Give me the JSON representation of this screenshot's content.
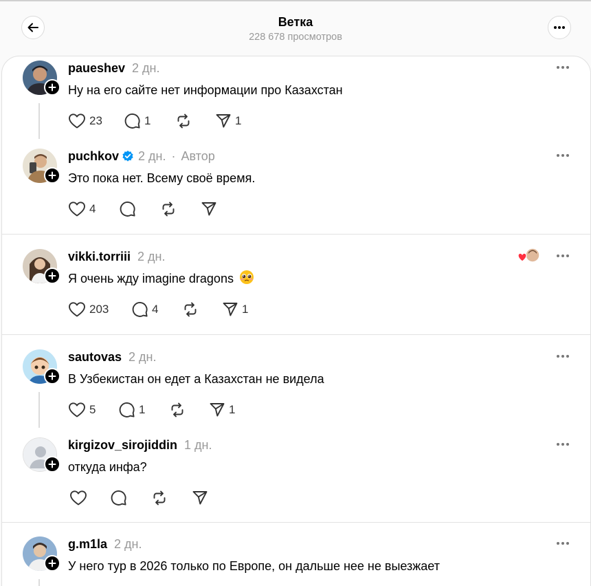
{
  "header": {
    "title": "Ветка",
    "subtitle": "228 678 просмотров"
  },
  "posts": [
    {
      "username": "paueshev",
      "time": "2 дн.",
      "text": "Ну на его сайте нет информации про Казахстан",
      "likes": "23",
      "replies": "1",
      "reposts": "",
      "shares": "1",
      "avatar_color": "#3b3b45"
    },
    {
      "username": "puchkov",
      "time": "2 дн.",
      "author_label": "Автор",
      "text": "Это пока нет. Всему своё время.",
      "likes": "4",
      "replies": "",
      "reposts": "",
      "shares": "",
      "avatar_color": "#c9a98a"
    },
    {
      "username": "vikki.torriii",
      "time": "2 дн.",
      "text": "Я очень жду imagine dragons",
      "likes": "203",
      "replies": "4",
      "reposts": "",
      "shares": "1",
      "avatar_color": "#5a4a3c"
    },
    {
      "username": "sautovas",
      "time": "2 дн.",
      "text": "В Узбекистан он едет а Казахстан не видела",
      "likes": "5",
      "replies": "1",
      "reposts": "",
      "shares": "1",
      "avatar_color": "#8fc7e8"
    },
    {
      "username": "kirgizov_sirojiddin",
      "time": "1 дн.",
      "text": "откуда инфа?",
      "likes": "",
      "replies": "",
      "reposts": "",
      "shares": "",
      "avatar_color": "#e4e6ea"
    },
    {
      "username": "g.m1la",
      "time": "2 дн.",
      "text": "У него тур в 2026 только по Европе, он дальше нее не выезжает",
      "avatar_color": "#6d8fb3"
    }
  ],
  "colors": {
    "verified": "#0095f6",
    "like_heart": "#ff3040",
    "muted_text": "#999999"
  },
  "icons": {
    "back": "arrow-left-icon",
    "more": "more-horizontal-icon",
    "like": "heart-icon",
    "reply": "comment-bubble-icon",
    "repost": "repost-icon",
    "share": "send-icon"
  }
}
